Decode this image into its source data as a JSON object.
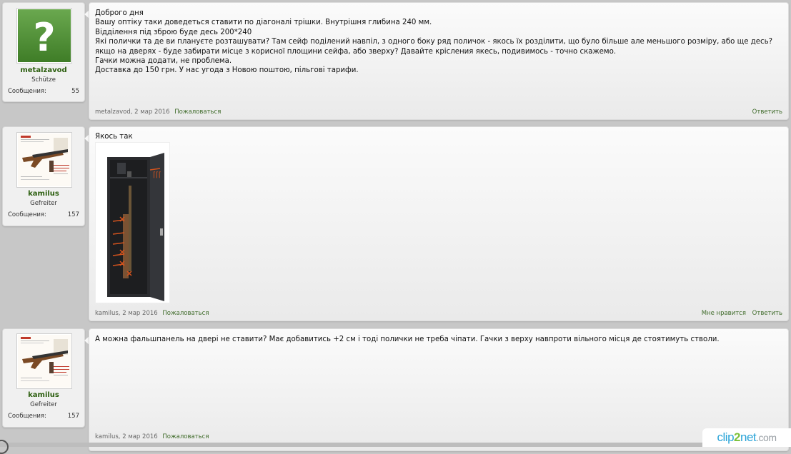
{
  "posts": [
    {
      "username": "metalzavod",
      "rank": "Schütze",
      "messages_label": "Сообщения:",
      "messages_count": "55",
      "avatar": "question-mark-avatar",
      "lines": [
        "Доброго дня",
        "Вашу оптіку таки доведеться ставити по діагоналі трішки. Внутрішня глибина 240 мм.",
        "Відділення під зброю буде десь 200*240",
        "Які полички та де ви плануєте розташувати? Там сейф поділений навпіл, з одного боку ряд поличок - якось їх розділити, що було більше але меньшого розміру, або ще десь? якщо на дверях - буде забирати місце з корисної площини сейфа, або зверху? Давайте крісления якесь, подивимось - точно скажемо.",
        "Гачки можна додати, не проблема.",
        "Доставка до 150 грн. У нас угода з Новою поштою, пільгові тарифи."
      ],
      "meta": "metalzavod, 2 мар 2016",
      "complain": "Пожаловаться",
      "reply": "Ответить"
    },
    {
      "username": "kamilus",
      "rank": "Gefreiter",
      "messages_label": "Сообщения:",
      "messages_count": "157",
      "avatar": "rifle-poster-avatar",
      "lines": [
        "Якось так"
      ],
      "attachment": "gun-safe-photo",
      "meta": "kamilus, 2 мар 2016",
      "complain": "Пожаловаться",
      "like": "Мне нравится",
      "reply": "Ответить"
    },
    {
      "username": "kamilus",
      "rank": "Gefreiter",
      "messages_label": "Сообщения:",
      "messages_count": "157",
      "avatar": "rifle-poster-avatar",
      "lines": [
        "А можна фальшпанель на двері не ставити? Має добавитись +2 см і тоді полички не треба чіпати. Гачки з верху навпроти вільного місця де стоятимуть стволи."
      ],
      "meta": "kamilus, 2 мар 2016",
      "complain": "Пожаловаться"
    }
  ],
  "watermark": {
    "a": "clip",
    "b": "2",
    "c": "net",
    "d": ".com"
  }
}
